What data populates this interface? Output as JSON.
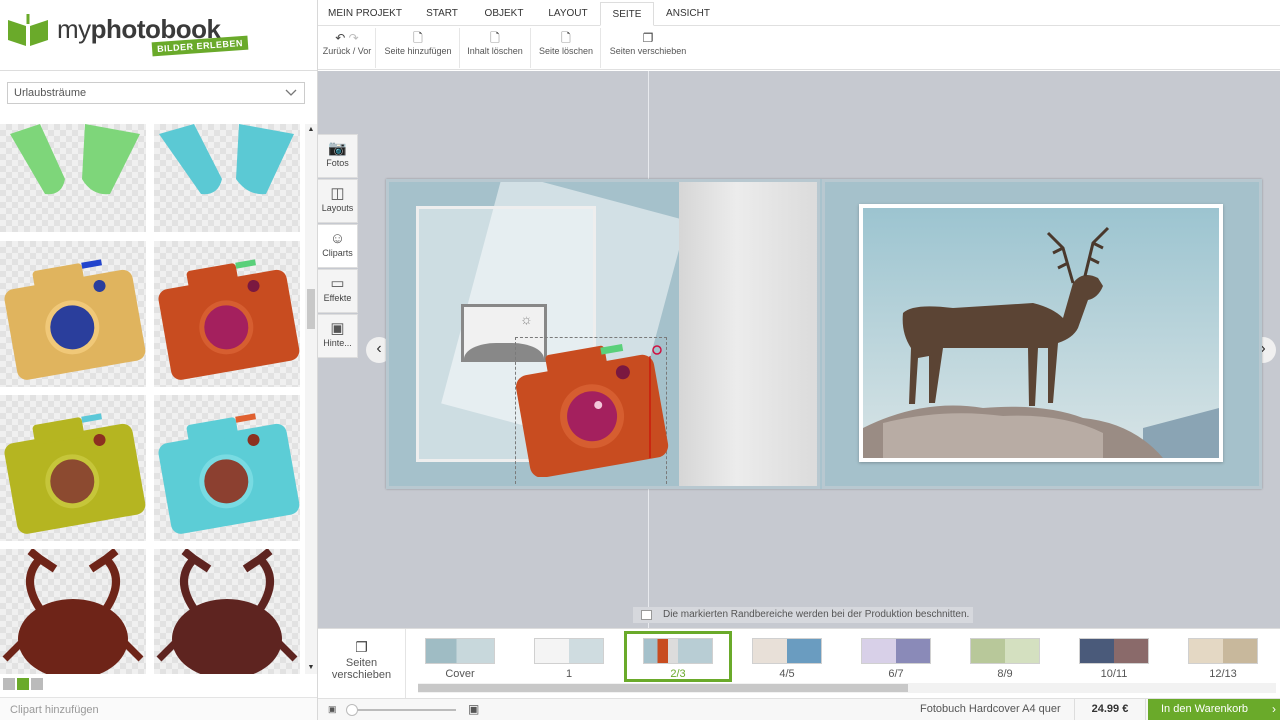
{
  "brand": {
    "name_light": "my",
    "name_bold": "photobook",
    "tagline": "BILDER ERLEBEN",
    "color": "#6aaa2a"
  },
  "menu": {
    "tabs": [
      {
        "label": "MEIN PROJEKT",
        "active": false
      },
      {
        "label": "START",
        "active": false
      },
      {
        "label": "OBJEKT",
        "active": false
      },
      {
        "label": "LAYOUT",
        "active": false
      },
      {
        "label": "SEITE",
        "active": true
      },
      {
        "label": "ANSICHT",
        "active": false
      }
    ]
  },
  "toolbar": {
    "undo_redo": "Zurück / Vor",
    "add_page": "Seite hinzufügen",
    "delete_content": "Inhalt löschen",
    "delete_page": "Seite löschen",
    "move_pages": "Seiten verschieben"
  },
  "sidebar": {
    "category": "Urlaubsträume",
    "cliparts": [
      "green-flippers",
      "blue-flippers",
      "yellow-camera",
      "red-camera",
      "olive-camera",
      "cyan-camera",
      "crab",
      "crab"
    ],
    "add_clipart": "Clipart hinzufügen"
  },
  "side_tools": [
    {
      "label": "Fotos",
      "icon": "camera-icon",
      "active": false
    },
    {
      "label": "Layouts",
      "icon": "layout-icon",
      "active": false
    },
    {
      "label": "Cliparts",
      "icon": "smiley-icon",
      "active": true
    },
    {
      "label": "Effekte",
      "icon": "frame-icon",
      "active": false
    },
    {
      "label": "Hinte...",
      "icon": "background-icon",
      "active": false
    }
  ],
  "canvas": {
    "trim_notice": "Die markierten Randbereiche werden bei der Produktion beschnitten."
  },
  "filmstrip": {
    "move_pages_label": "Seiten verschieben",
    "pages": [
      {
        "label": "Cover",
        "active": false
      },
      {
        "label": "1",
        "active": false
      },
      {
        "label": "2/3",
        "active": true
      },
      {
        "label": "4/5",
        "active": false
      },
      {
        "label": "6/7",
        "active": false
      },
      {
        "label": "8/9",
        "active": false
      },
      {
        "label": "10/11",
        "active": false
      },
      {
        "label": "12/13",
        "active": false
      }
    ]
  },
  "footer": {
    "product": "Fotobuch Hardcover A4 quer",
    "price": "24.99 €",
    "cart_button": "In den Warenkorb"
  }
}
